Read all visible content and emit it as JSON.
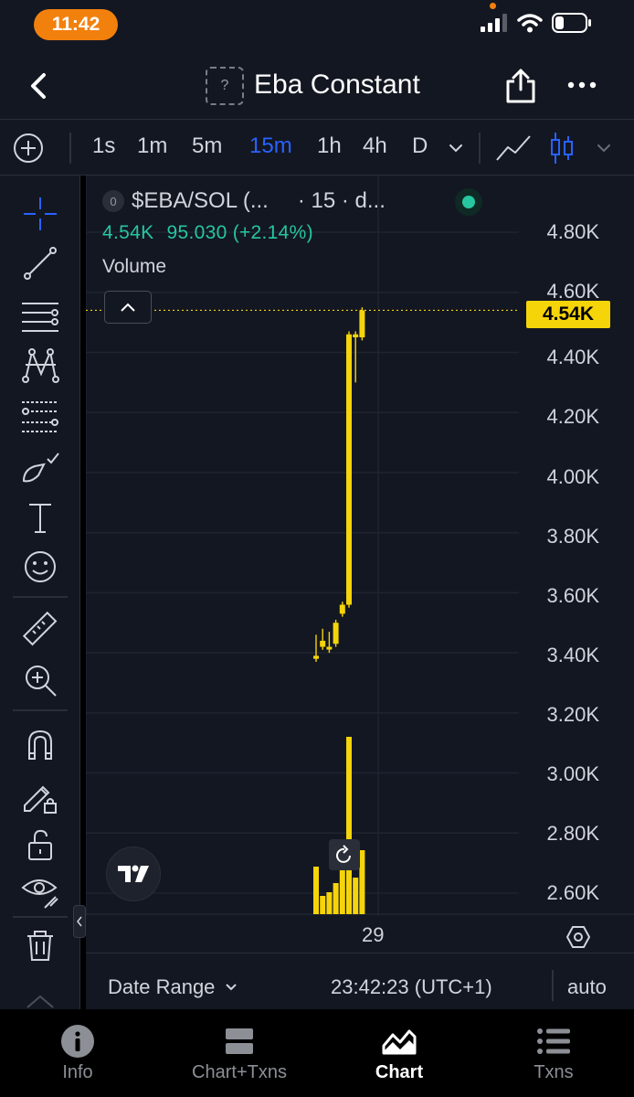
{
  "status": {
    "time": "11:42",
    "icons": [
      "cellular-signal-icon",
      "wifi-icon",
      "battery-icon"
    ]
  },
  "header": {
    "title": "Eba Constant",
    "token_icon_glyph": "?"
  },
  "timeframes": {
    "items": [
      "1s",
      "1m",
      "5m",
      "15m",
      "1h",
      "4h",
      "D"
    ],
    "active": "15m"
  },
  "legend": {
    "badge": "0",
    "symbol": "$EBA/SOL (...",
    "interval": "· 15 · d...",
    "open_value": "4.54K",
    "change": "95.030 (+2.14%)",
    "volume_label": "Volume"
  },
  "price_axis": {
    "labels": [
      "4.80K",
      "4.60K",
      "4.40K",
      "4.20K",
      "4.00K",
      "3.80K",
      "3.60K",
      "3.40K",
      "3.20K",
      "3.00K",
      "2.80K",
      "2.60K"
    ],
    "current": "4.54K"
  },
  "time_axis": {
    "label": "29"
  },
  "footer": {
    "date_range": "Date Range",
    "clock": "23:42:23 (UTC+1)",
    "scale": "auto"
  },
  "tabs": [
    {
      "label": "Info",
      "icon": "info-icon"
    },
    {
      "label": "Chart+Txns",
      "icon": "split-view-icon"
    },
    {
      "label": "Chart",
      "icon": "chart-icon"
    },
    {
      "label": "Txns",
      "icon": "list-icon"
    }
  ],
  "colors": {
    "accent": "#2962ff",
    "candle": "#f5d40a",
    "up": "#26c6a1",
    "status_pill": "#f2800d"
  },
  "chart_data": {
    "type": "candlestick",
    "ylim": [
      2500,
      4900
    ],
    "current_price": 4540,
    "candles": [
      {
        "o": 3380,
        "h": 3460,
        "l": 3370,
        "c": 3390
      },
      {
        "o": 3420,
        "h": 3480,
        "l": 3410,
        "c": 3440
      },
      {
        "o": 3420,
        "h": 3470,
        "l": 3400,
        "c": 3420
      },
      {
        "o": 3430,
        "h": 3510,
        "l": 3420,
        "c": 3500
      },
      {
        "o": 3530,
        "h": 3570,
        "l": 3520,
        "c": 3560
      },
      {
        "o": 3560,
        "h": 4470,
        "l": 3550,
        "c": 4460
      },
      {
        "o": 4460,
        "h": 4470,
        "l": 4300,
        "c": 4450
      },
      {
        "o": 4450,
        "h": 4550,
        "l": 4440,
        "c": 4540
      }
    ],
    "volume_relative": [
      0.26,
      0.1,
      0.12,
      0.17,
      0.29,
      0.97,
      0.2,
      0.35
    ]
  }
}
